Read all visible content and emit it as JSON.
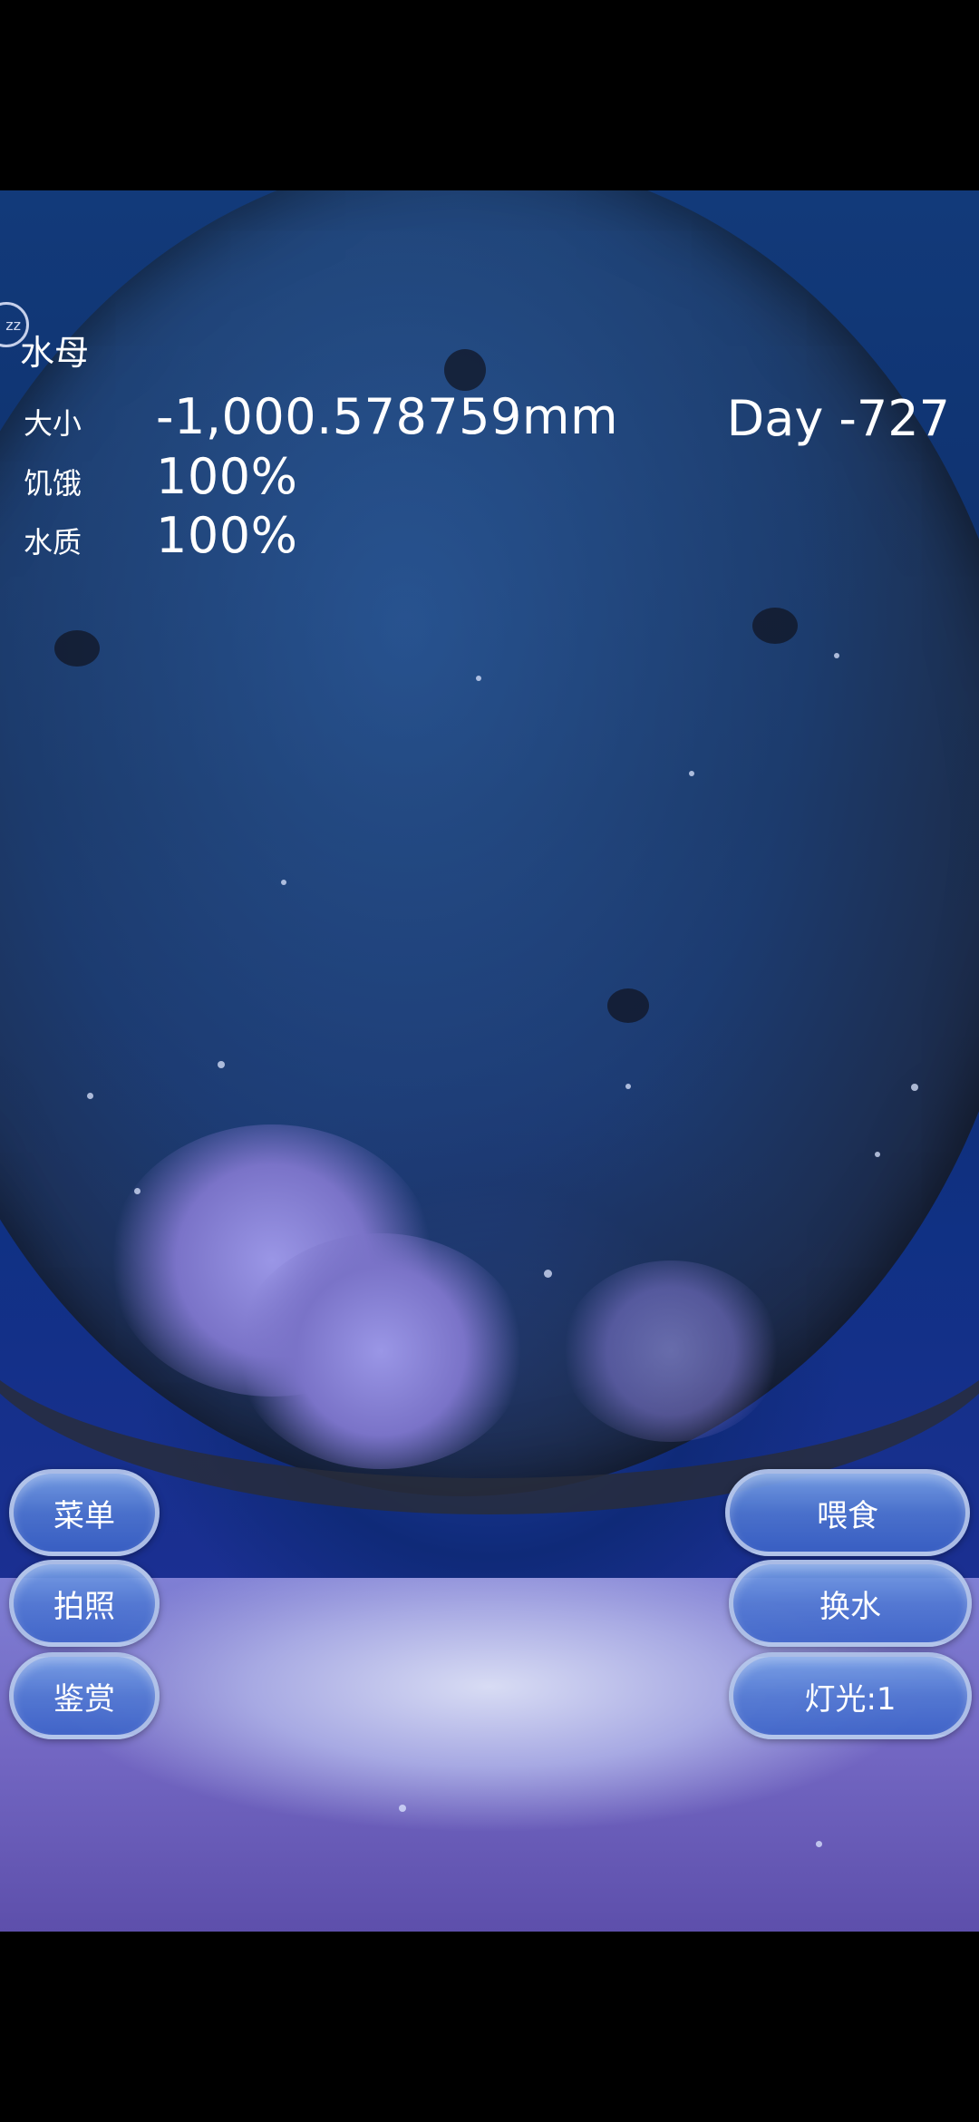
{
  "status": {
    "title": "水母",
    "size_label": "大小",
    "size_value": "-1,000.578759mm",
    "day": "Day -727",
    "hunger_label": "饥饿",
    "hunger_value": "100%",
    "water_label": "水质",
    "water_value": "100%",
    "sleep_icon_text": "zz"
  },
  "buttons": {
    "menu": "菜单",
    "photo": "拍照",
    "appreciate": "鉴赏",
    "feed": "喂食",
    "change_water": "换水",
    "light": "灯光:1"
  }
}
